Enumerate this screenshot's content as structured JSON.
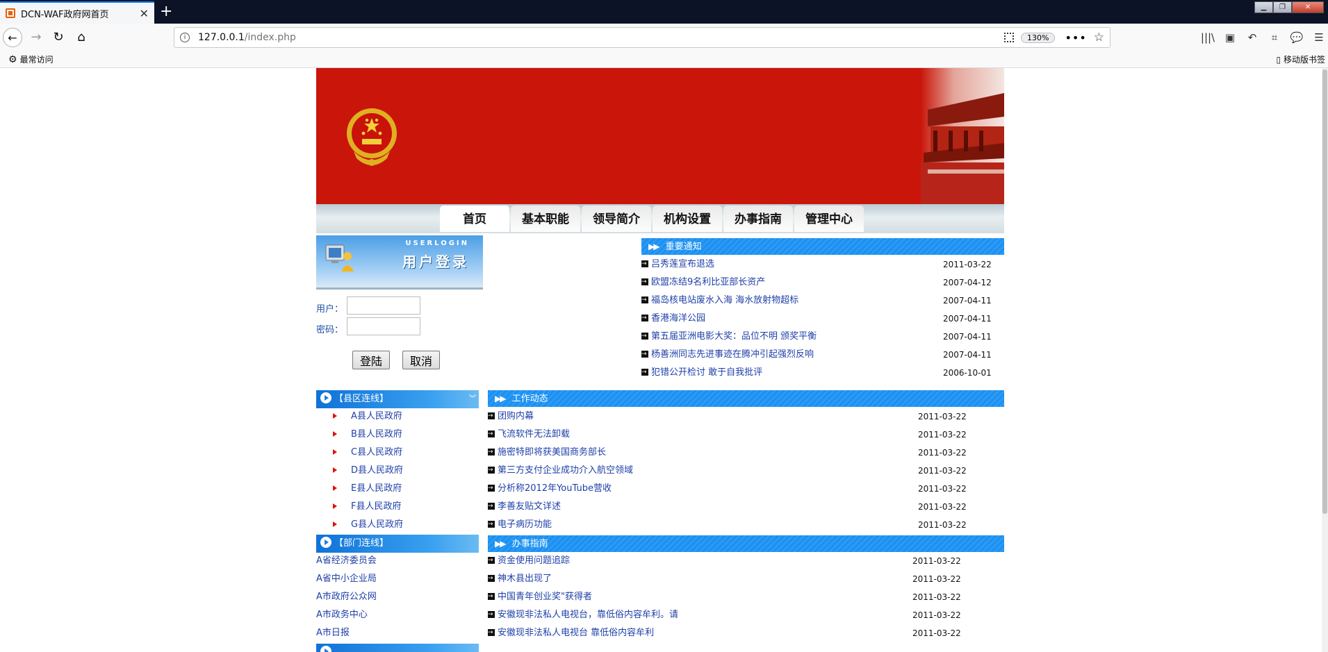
{
  "browser": {
    "tab_title": "DCN-WAF政府网首页",
    "tab_close": "✕",
    "new_tab": "+",
    "url_host": "127.0.0.1",
    "url_path": "/index.php",
    "zoom": "130%",
    "bookmarks": {
      "often": "最常访问",
      "mobile": "移动版书签"
    }
  },
  "nav": [
    "首页",
    "基本职能",
    "领导简介",
    "机构设置",
    "办事指南",
    "管理中心"
  ],
  "login": {
    "title_en": "USERLOGIN",
    "title_cn": "用户登录",
    "user_label": "用户：",
    "pass_label": "密码：",
    "submit": "登陆",
    "cancel": "取消"
  },
  "notice": {
    "title": "重要通知",
    "items": [
      {
        "text": "吕秀莲宣布退选",
        "date": "2011-03-22"
      },
      {
        "text": "欧盟冻结9名利比亚部长资产",
        "date": "2007-04-12"
      },
      {
        "text": "福岛核电站废水入海 海水放射物超标",
        "date": "2007-04-11"
      },
      {
        "text": "香港海洋公园",
        "date": "2007-04-11"
      },
      {
        "text": "第五届亚洲电影大奖：品位不明 颁奖平衡",
        "date": "2007-04-11"
      },
      {
        "text": "杨善洲同志先进事迹在腾冲引起强烈反响",
        "date": "2007-04-11"
      },
      {
        "text": "犯错公开检讨 敢于自我批评",
        "date": "2006-10-01"
      }
    ]
  },
  "county": {
    "title": "【县区连线】",
    "items": [
      "A县人民政府",
      "B县人民政府",
      "C县人民政府",
      "D县人民政府",
      "E县人民政府",
      "F县人民政府",
      "G县人民政府"
    ]
  },
  "dept": {
    "title": "【部门连线】",
    "items": [
      "A省经济委员会",
      "A省中小企业局",
      "A市政府公众网",
      "A市政务中心",
      "A市日报"
    ]
  },
  "work": {
    "title": "工作动态",
    "items": [
      {
        "text": "团购内幕",
        "date": "2011-03-22"
      },
      {
        "text": "飞流软件无法卸载",
        "date": "2011-03-22"
      },
      {
        "text": "施密特即将获美国商务部长",
        "date": "2011-03-22"
      },
      {
        "text": "第三方支付企业成功介入航空领域",
        "date": "2011-03-22"
      },
      {
        "text": "分析称2012年YouTube营收",
        "date": "2011-03-22"
      },
      {
        "text": "李善友贴文详述",
        "date": "2011-03-22"
      },
      {
        "text": "电子病历功能",
        "date": "2011-03-22"
      }
    ]
  },
  "guide": {
    "title": "办事指南",
    "items": [
      {
        "text": "资金使用问题追踪",
        "date": "2011-03-22"
      },
      {
        "text": "神木县出现了",
        "date": "2011-03-22"
      },
      {
        "text": "中国青年创业奖\"获得者",
        "date": "2011-03-22"
      },
      {
        "text": "安徽现非法私人电视台，靠低俗内容牟利。请",
        "date": "2011-03-22"
      },
      {
        "text": "安徽现非法私人电视台 靠低俗内容牟利",
        "date": "2011-03-22"
      }
    ]
  },
  "icons": {
    "back": "back-icon",
    "forward": "forward-icon",
    "reload": "reload-icon",
    "home": "home-icon",
    "library": "library-icon",
    "sidebar": "sidebar-icon",
    "menu": "hamburger-icon"
  },
  "colors": {
    "banner_red": "#c9150a",
    "bar_blue": "#1d8ff0",
    "link_blue": "#1e3fa8"
  }
}
